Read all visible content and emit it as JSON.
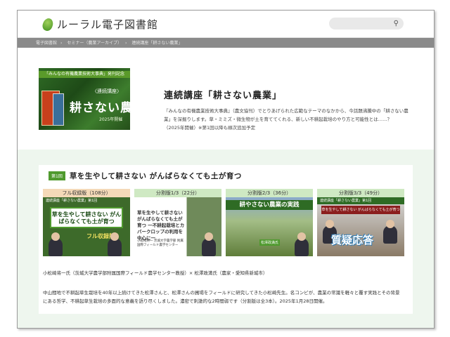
{
  "header": {
    "logo_text": "ルーラル電子図書館",
    "search_placeholder": ""
  },
  "breadcrumb": {
    "items": [
      "電子図書館",
      "セミナー（農業アーカイブ）",
      "連続講座「耕さない農業」"
    ]
  },
  "intro": {
    "cover": {
      "ribbon": "「みんなの有機農業技術大事典」発刊記念",
      "sub": "〈連続講座〉",
      "big": "耕さない農業",
      "year": "2025年開催"
    },
    "title": "連続講座「耕さない農業」",
    "description": "『みんなの有機農業技術大事典』（農文協刊）でとりあげられた広範なテーマのなかから、今話題沸騰中の「耕さない農業」を深掘りします。草・ミミズ・微生物が土を育ててくれる、新しい不耕起栽培のやり方と可能性とは……？　（2025年開催）※第1回以降も順次追加予定"
  },
  "lesson": {
    "badge": "第1回",
    "title": "草を生やして耕さない がんばらなくても土が育つ",
    "videos": [
      {
        "label": "フル収録版（108分）",
        "top": "連続講座「耕さない農業」第1回",
        "main": "草を生やして耕さない がんばらなくても土が育つ",
        "tag": "フル収録版"
      },
      {
        "label": "分割版1/3（22分）",
        "top": "",
        "main": "草を生やして耕さない がんばらなくても土が育つ 一不耕起栽培とカバークロップの利用を中心に一",
        "small": "小松崎将一 茨城大学農学部 附属国際フィールド農学センター"
      },
      {
        "label": "分割版2/3（36分）",
        "main": "耕やさない農業の実践",
        "tag": "松澤政満氏"
      },
      {
        "label": "分割版3/3（49分）",
        "top": "連続講座「耕さない農業」第1回",
        "main": "草を生やして耕さない がんばらなくても土が育つ",
        "tag": "質疑応答"
      }
    ],
    "speakers": "小松崎将一氏（茨城大学農学部附属国際フィールド農学センター教授）× 松澤政満氏（農家・愛知県新城市）",
    "description": "中山間地で不耕起草生栽培を40年以上続けてきた松澤さんと、松澤さんの圃場をフィールドに研究してきた小松崎先生。名コンビが、農業の常識を軽々と覆す実践とその背景にある哲学、不耕起草生栽培の多面的な意義を語り尽くしました。濃密で刺激的な2時間弱です（分割版は全3本）。2025年1月28日開催。"
  },
  "colors": {
    "accent_green": "#4f9a2e",
    "section_bg": "#eef6ee"
  }
}
